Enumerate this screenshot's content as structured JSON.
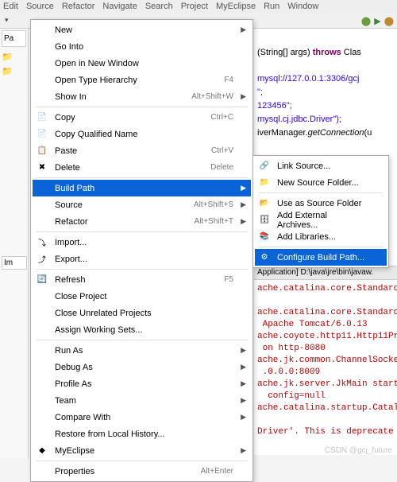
{
  "menubar": [
    "Edit",
    "Source",
    "Refactor",
    "Navigate",
    "Search",
    "Project",
    "MyEclipse",
    "Run",
    "Window"
  ],
  "left_tabs": {
    "pa": "Pa",
    "im": "Im"
  },
  "context_menu": {
    "groups": [
      [
        {
          "label": "New",
          "arrow": true,
          "icon": ""
        },
        {
          "label": "Go Into"
        },
        {
          "label": "Open in New Window"
        },
        {
          "label": "Open Type Hierarchy",
          "shortcut": "F4"
        },
        {
          "label": "Show In",
          "shortcut": "Alt+Shift+W",
          "arrow": true
        }
      ],
      [
        {
          "label": "Copy",
          "shortcut": "Ctrl+C",
          "icon": "copy"
        },
        {
          "label": "Copy Qualified Name",
          "icon": "copyq"
        },
        {
          "label": "Paste",
          "shortcut": "Ctrl+V",
          "icon": "paste"
        },
        {
          "label": "Delete",
          "shortcut": "Delete",
          "icon": "delete"
        }
      ],
      [
        {
          "label": "Build Path",
          "arrow": true,
          "selected": true
        },
        {
          "label": "Source",
          "shortcut": "Alt+Shift+S",
          "arrow": true
        },
        {
          "label": "Refactor",
          "shortcut": "Alt+Shift+T",
          "arrow": true
        }
      ],
      [
        {
          "label": "Import...",
          "icon": "import"
        },
        {
          "label": "Export...",
          "icon": "export"
        }
      ],
      [
        {
          "label": "Refresh",
          "shortcut": "F5",
          "icon": "refresh"
        },
        {
          "label": "Close Project"
        },
        {
          "label": "Close Unrelated Projects"
        },
        {
          "label": "Assign Working Sets..."
        }
      ],
      [
        {
          "label": "Run As",
          "arrow": true
        },
        {
          "label": "Debug As",
          "arrow": true
        },
        {
          "label": "Profile As",
          "arrow": true
        },
        {
          "label": "Team",
          "arrow": true
        },
        {
          "label": "Compare With",
          "arrow": true
        },
        {
          "label": "Restore from Local History..."
        },
        {
          "label": "MyEclipse",
          "arrow": true,
          "icon": "me"
        }
      ],
      [
        {
          "label": "Properties",
          "shortcut": "Alt+Enter"
        }
      ]
    ]
  },
  "submenu": {
    "groups": [
      [
        {
          "label": "Link Source...",
          "icon": "link"
        },
        {
          "label": "New Source Folder...",
          "icon": "srcfolder"
        }
      ],
      [
        {
          "label": "Use as Source Folder",
          "icon": "usesrc"
        },
        {
          "label": "Add External Archives...",
          "icon": "jar"
        },
        {
          "label": "Add Libraries...",
          "icon": "lib"
        }
      ],
      [
        {
          "label": "Configure Build Path...",
          "icon": "conf",
          "selected": true
        }
      ]
    ]
  },
  "editor": {
    "line1_a": "(String[] args) ",
    "line1_kw": "throws",
    "line1_b": " Clas",
    "line2": "mysql://127.0.0.1:3306/gcj",
    "line3": "\";",
    "line4": "123456\";",
    "line5": "mysql.cj.jdbc.Driver\");",
    "line6_a": "iverManager.",
    "line6_m": "getConnection",
    "line6_b": "(u"
  },
  "console_header": "Application] D:\\java\\jre\\bin\\javaw.",
  "console_lines": [
    "ache.catalina.core.Standard",
    "",
    "ache.catalina.core.Standard",
    " Apache Tomcat/6.0.13",
    "ache.coyote.http11.Http11Pr",
    " on http-8080",
    "ache.jk.common.ChannelSocke",
    " .0.0.0:8009",
    "ache.jk.server.JkMain start",
    "  config=null",
    "ache.catalina.startup.Catal",
    "",
    "Driver'. This is deprecate"
  ],
  "watermark": "CSDN @gcj_future"
}
